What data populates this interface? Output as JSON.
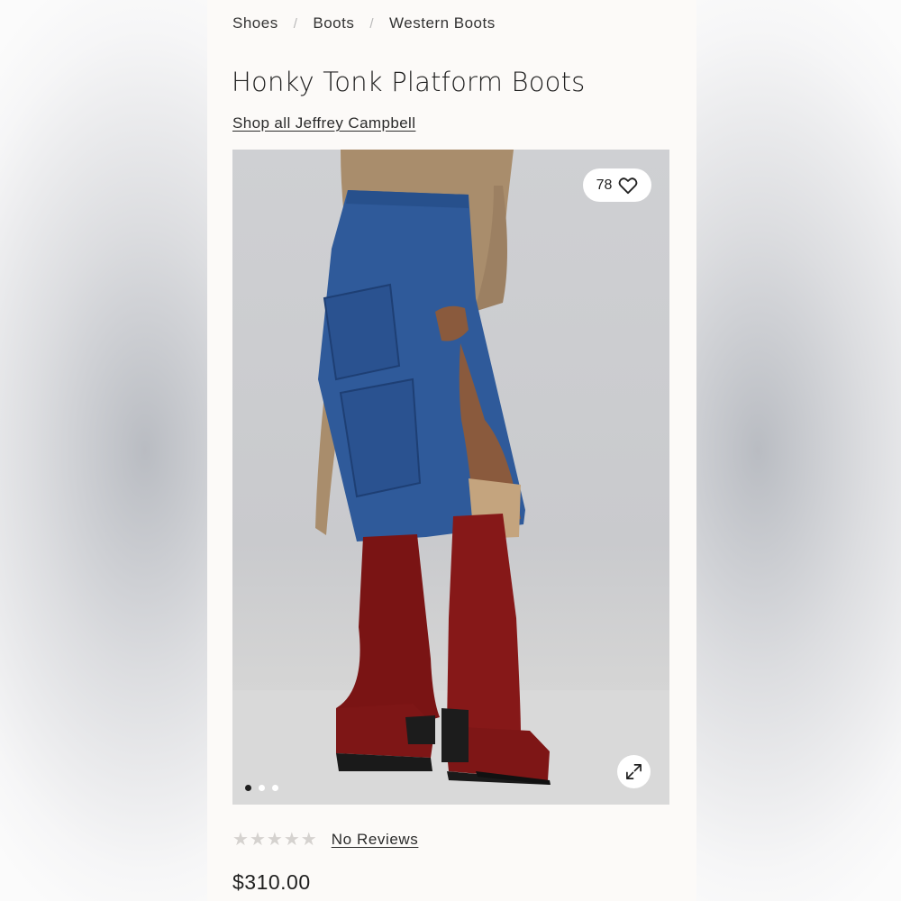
{
  "breadcrumb": {
    "items": [
      "Shoes",
      "Boots",
      "Western Boots"
    ],
    "separator": "/"
  },
  "product": {
    "title": "Honky Tonk Platform Boots",
    "brand_link": "Shop all Jeffrey Campbell",
    "favorites_count": "78",
    "reviews_label": "No Reviews",
    "rating": 0,
    "rating_max": 5,
    "price": "$310.00"
  },
  "gallery": {
    "image_count": 3,
    "active_index": 0
  },
  "icons": {
    "favorite": "heart-icon",
    "expand": "expand-icon",
    "star": "star-icon"
  },
  "colors": {
    "page_background": "#fcfaf8",
    "boot_red": "#7a1414",
    "denim": "#2f5a9a",
    "star_empty": "#d5d2cf"
  }
}
